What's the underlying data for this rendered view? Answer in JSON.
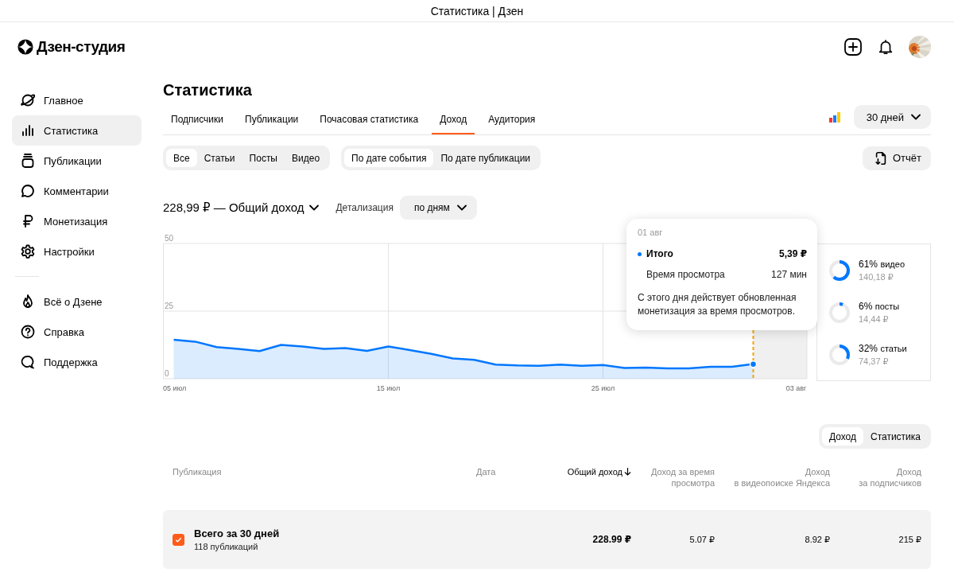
{
  "window": {
    "title": "Статистика | Дзен"
  },
  "app": {
    "logo": "Дзен-студия"
  },
  "sidebar": {
    "items": [
      {
        "label": "Главное",
        "selected": false
      },
      {
        "label": "Статистика",
        "selected": true
      },
      {
        "label": "Публикации",
        "selected": false
      },
      {
        "label": "Комментарии",
        "selected": false
      },
      {
        "label": "Монетизация",
        "selected": false
      },
      {
        "label": "Настройки",
        "selected": false
      }
    ],
    "footer_items": [
      {
        "label": "Всё о Дзене"
      },
      {
        "label": "Справка"
      },
      {
        "label": "Поддержка"
      }
    ]
  },
  "page": {
    "title": "Статистика",
    "tabs": [
      {
        "label": "Подписчики",
        "selected": false
      },
      {
        "label": "Публикации",
        "selected": false
      },
      {
        "label": "Почасовая статистика",
        "selected": false
      },
      {
        "label": "Доход",
        "selected": true
      },
      {
        "label": "Аудитория",
        "selected": false
      }
    ],
    "period": "30 дней",
    "type_filter": [
      {
        "label": "Все",
        "selected": true
      },
      {
        "label": "Статьи",
        "selected": false
      },
      {
        "label": "Посты",
        "selected": false
      },
      {
        "label": "Видео",
        "selected": false
      }
    ],
    "date_filter": [
      {
        "label": "По дате события",
        "selected": true
      },
      {
        "label": "По дате публикации",
        "selected": false
      }
    ],
    "report_button": "Отчёт",
    "metric": "228,99 ₽ — Общий доход",
    "detail_label": "Детализация",
    "detail_value": "по дням"
  },
  "chart": {
    "chart_data": {
      "type": "area",
      "categories": [
        "05 июл",
        null,
        null,
        null,
        null,
        null,
        null,
        null,
        null,
        null,
        "15 июл",
        null,
        null,
        null,
        null,
        null,
        null,
        null,
        null,
        null,
        "25 июл",
        null,
        null,
        null,
        null,
        null,
        null,
        null,
        null,
        "03 авг"
      ],
      "ylim": [
        0,
        50
      ],
      "yticks": [
        0,
        25,
        50
      ],
      "grid": true,
      "series": [
        {
          "name": "Итого",
          "color": "#0077ff",
          "values": [
            14.4,
            13.7,
            11.7,
            11,
            10.2,
            12.5,
            11.9,
            11,
            11.3,
            10.3,
            11.9,
            10.6,
            9.2,
            7.5,
            7,
            5.2,
            4.9,
            4.8,
            5.2,
            4.8,
            5.1,
            4,
            4.1,
            3.8,
            3.8,
            4.4,
            4.4,
            5.4,
            null,
            null
          ]
        }
      ]
    },
    "tooltip": {
      "date": "01 авг",
      "total_value": "5,39 ₽",
      "rows": [
        {
          "label": "Время просмотра",
          "value": "127 мин"
        }
      ],
      "note": "С этого дня действует обновленная монетизация за время просмотров."
    },
    "breakdown": [
      {
        "percent": "61%",
        "label": "видео",
        "amount": "140,18 ₽",
        "level": 0.61
      },
      {
        "percent": "6%",
        "label": "посты",
        "amount": "14,44 ₽",
        "level": 0.06
      },
      {
        "percent": "32%",
        "label": "статьи",
        "amount": "74,37 ₽",
        "level": 0.32
      }
    ]
  },
  "table": {
    "view_toggle": [
      {
        "label": "Доход",
        "selected": true
      },
      {
        "label": "Статистика",
        "selected": false
      }
    ],
    "columns": [
      {
        "label": "Публикация",
        "sorted": false
      },
      {
        "label": "Дата",
        "sorted": false
      },
      {
        "label": "Общий доход",
        "sorted": true
      },
      {
        "label": "Доход за время\nпросмотра",
        "sorted": false
      },
      {
        "label": "Доход\nв видеопоиске Яндекса",
        "sorted": false
      },
      {
        "label": "Доход\nза подписчиков",
        "sorted": false
      }
    ],
    "rows": [
      {
        "checked": true,
        "cells": [
          {
            "title": "Всего за 30 дней",
            "subtitle": "118 публикаций"
          },
          "",
          "228.99 ₽",
          "5.07 ₽",
          "8.92 ₽",
          "215 ₽"
        ]
      }
    ]
  }
}
